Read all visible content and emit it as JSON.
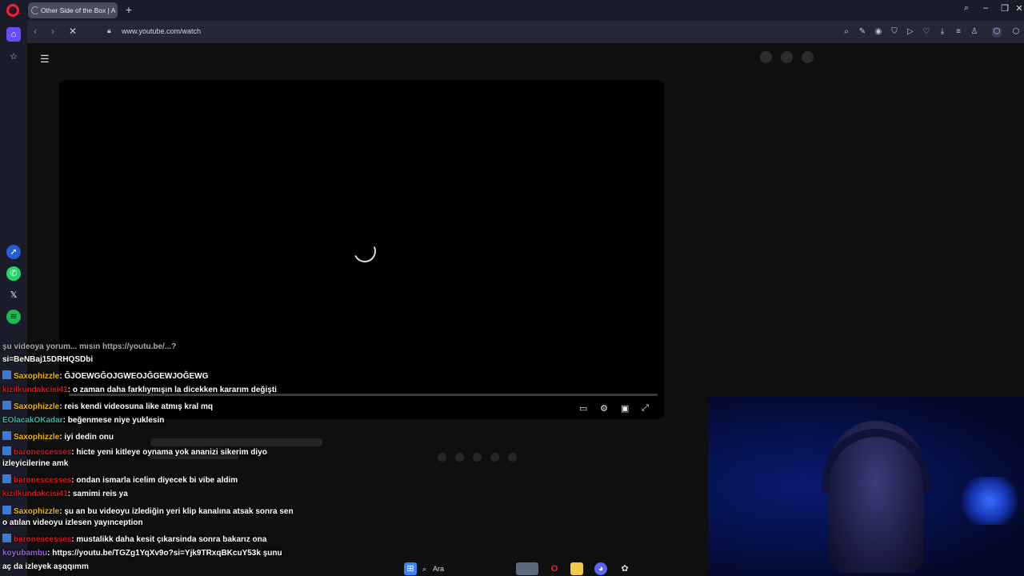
{
  "browser": {
    "tab_title": "Other Side of the Box | A",
    "new_tab": "+",
    "url": "www.youtube.com/watch"
  },
  "chat": {
    "messages": [
      {
        "user": "",
        "text": "şu videoya yorum... mısın https://youtu.be/...?",
        "cont": "si=BeNBaj15DRHQSDbi",
        "color": "#2fb7a3",
        "badge": false
      },
      {
        "user": "Saxophizzle",
        "text": ": ĞJOEWGĞOJGWEOJĞGEWJOĞEWG",
        "color": "#f4b400",
        "badge": true
      },
      {
        "user": "kizilkundakcisi41",
        "text": ": o zaman daha farklıymışın la dicekken kararım değişti",
        "color": "#d4171e",
        "badge": false
      },
      {
        "user": "Saxophizzle",
        "text": ": reis kendi videosuna like atmış kral mq",
        "color": "#f4b400",
        "badge": true
      },
      {
        "user": "EOlacakOKadar",
        "text": ": beğenmese niye yuklesin",
        "color": "#2fb7a3",
        "badge": false
      },
      {
        "user": "Saxophizzle",
        "text": ": iyi dedin onu",
        "color": "#f4b400",
        "badge": true
      },
      {
        "user": "baronescesses",
        "text": ": hicte yeni kitleye oynama yok ananizi sikerim diyo",
        "cont": "izleyicilerine amk",
        "color": "#d4171e",
        "badge": true
      },
      {
        "user": "baronescesses",
        "text": ": ondan ismarla icelim diyecek bi vibe aldim",
        "color": "#d4171e",
        "badge": true
      },
      {
        "user": "kizilkundakcisi41",
        "text": ": samimi reis ya",
        "color": "#d4171e",
        "badge": false
      },
      {
        "user": "Saxophizzle",
        "text": ": şu an bu videoyu izlediğin yeri klip kanalına atsak sonra sen",
        "cont": "o atılan videoyu izlesen yayınception",
        "color": "#f4b400",
        "badge": true
      },
      {
        "user": "baronescesses",
        "text": ": mustalikk daha kesit çıkarsinda sonra bakarız ona",
        "color": "#d4171e",
        "badge": true
      },
      {
        "user": "koyubambu",
        "text": ": https://youtu.be/TGZg1YqXv9o?si=Yjk9TRxqBKcuY53k şunu",
        "cont": "aç da izleyek aşqqımm",
        "color": "#9b5de5",
        "badge": false
      }
    ]
  },
  "taskbar": {
    "search_label": "Ara"
  },
  "colors": {
    "accent": "#ff1b2d",
    "bg": "#0f0f0f"
  }
}
